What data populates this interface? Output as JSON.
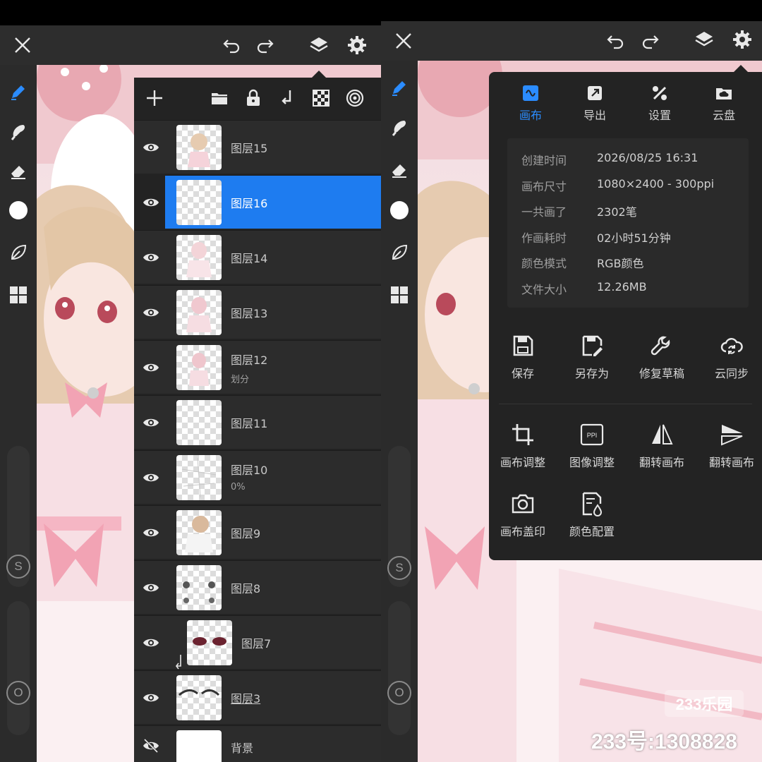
{
  "colors": {
    "accent": "#1e7cf0",
    "panel_bg": "#232323",
    "toolbar_bg": "#2b2b2b",
    "row_bg": "#2c2c2c",
    "selected_row": "#1e7cf0",
    "active_tab_text": "#2b8cff",
    "icon": "#e8e8e8"
  },
  "top_bar": {
    "icons": [
      "close-icon",
      "undo-icon",
      "redo-icon",
      "layers-icon",
      "settings-icon"
    ]
  },
  "tools": [
    "pen-icon",
    "smudge-icon",
    "eraser-icon",
    "color-swatch",
    "leaf-icon",
    "grid-icon"
  ],
  "left_sidebar": {
    "size_letter": "S",
    "opacity_letter": "O"
  },
  "layers_panel": {
    "toolbar_icons": [
      "add-icon",
      "folder-icon",
      "lock-icon",
      "merge-down-icon",
      "checker-icon",
      "target-icon"
    ],
    "layers": [
      {
        "name": "图层15",
        "sub": "",
        "visible": true,
        "selected": false
      },
      {
        "name": "图层16",
        "sub": "",
        "visible": true,
        "selected": true
      },
      {
        "name": "图层14",
        "sub": "",
        "visible": true,
        "selected": false
      },
      {
        "name": "图层13",
        "sub": "",
        "visible": true,
        "selected": false
      },
      {
        "name": "图层12",
        "sub": "划分",
        "visible": true,
        "selected": false
      },
      {
        "name": "图层11",
        "sub": "",
        "visible": true,
        "selected": false
      },
      {
        "name": "图层10",
        "sub": "0%",
        "visible": true,
        "selected": false
      },
      {
        "name": "图层9",
        "sub": "",
        "visible": true,
        "selected": false
      },
      {
        "name": "图层8",
        "sub": "",
        "visible": true,
        "selected": false
      },
      {
        "name": "图层7",
        "sub": "",
        "visible": true,
        "selected": false
      },
      {
        "name": "图层3",
        "sub": "",
        "visible": true,
        "selected": false
      },
      {
        "name": "背景",
        "sub": "",
        "visible": false,
        "selected": false
      }
    ]
  },
  "canvas_menu": {
    "tabs": [
      {
        "label": "画布",
        "icon": "canvas-icon",
        "active": true
      },
      {
        "label": "导出",
        "icon": "export-icon",
        "active": false
      },
      {
        "label": "设置",
        "icon": "settings-tools-icon",
        "active": false
      },
      {
        "label": "云盘",
        "icon": "cloud-drive-icon",
        "active": false
      }
    ],
    "info": [
      {
        "key": "创建时间",
        "value": "2026/08/25 16:31"
      },
      {
        "key": "画布尺寸",
        "value": "1080×2400 - 300ppi"
      },
      {
        "key": "一共画了",
        "value": "2302笔"
      },
      {
        "key": "作画耗时",
        "value": "02小时51分钟"
      },
      {
        "key": "颜色模式",
        "value": "RGB颜色"
      },
      {
        "key": "文件大小",
        "value": "12.26MB"
      }
    ],
    "actions_row1": [
      {
        "label": "保存",
        "icon": "save-icon"
      },
      {
        "label": "另存为",
        "icon": "save-as-icon"
      },
      {
        "label": "修复草稿",
        "icon": "repair-icon"
      },
      {
        "label": "云同步",
        "icon": "cloud-sync-icon"
      }
    ],
    "actions_row2": [
      {
        "label": "画布调整",
        "icon": "crop-icon"
      },
      {
        "label": "图像调整",
        "icon": "ppi-icon",
        "icon_text": "PPI"
      },
      {
        "label": "翻转画布",
        "icon": "flip-horizontal-icon"
      },
      {
        "label": "翻转画布",
        "icon": "flip-vertical-icon"
      }
    ],
    "actions_row3": [
      {
        "label": "画布盖印",
        "icon": "camera-icon"
      },
      {
        "label": "颜色配置",
        "icon": "color-config-icon"
      }
    ]
  },
  "watermark": {
    "badge": "233乐园",
    "id_text": "233号:1308828"
  }
}
